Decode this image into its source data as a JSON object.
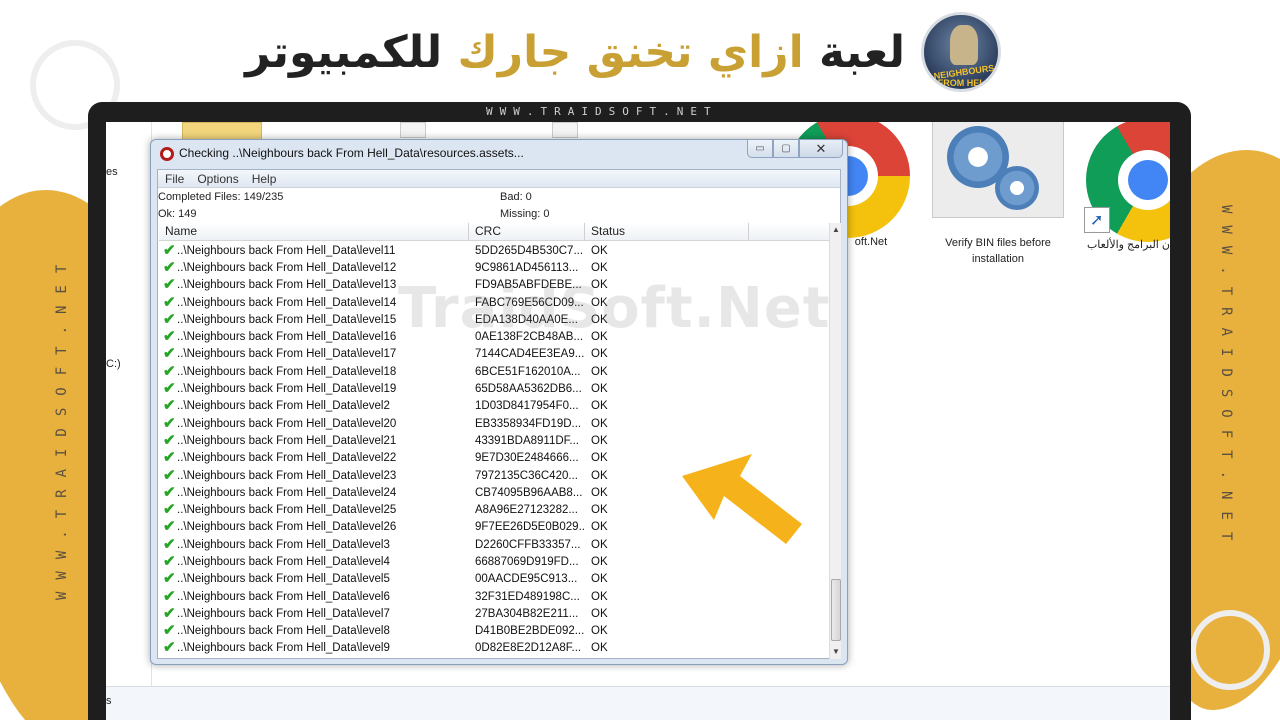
{
  "banner": {
    "headline_part1": "لعبة",
    "headline_part2": "ازاي تخنق جارك",
    "headline_part3": "للكمبيوتر",
    "logo_line1": "NEIGHBOURS",
    "logo_line2": "FROM HELL",
    "side_watermark": "WWW.TRAIDSOFT.NET",
    "url_watermark": "WWW.TRAIDSOFT.NET",
    "center_watermark": "TraidSoft.Net",
    "colors": {
      "gold": "#e8b13e",
      "headline_gold": "#c9a034",
      "dark": "#222222"
    }
  },
  "desktop": {
    "left_pane_text1": "es",
    "left_pane_text2": "C:)",
    "bottom_text": "s",
    "icons": [
      {
        "icon": "chrome-icon",
        "label": "oft.Net"
      },
      {
        "icon": "gears-icon",
        "label": "Verify BIN files before installation"
      },
      {
        "icon": "chrome-icon",
        "label": "ن البرامج والألعاب"
      }
    ]
  },
  "window": {
    "title": "Checking ..\\Neighbours back From Hell_Data\\resources.assets...",
    "buttons": {
      "minimize": "▭",
      "maximize": "▢",
      "close": "✕"
    },
    "menu": [
      "File",
      "Options",
      "Help"
    ],
    "stats": {
      "completed": "Completed Files: 149/235",
      "ok": "Ok: 149",
      "bad": "Bad: 0",
      "missing": "Missing: 0"
    },
    "columns": [
      "Name",
      "CRC",
      "Status"
    ],
    "rows": [
      {
        "name": "..\\Neighbours back From Hell_Data\\level11",
        "crc": "5DD265D4B530C7...",
        "status": "OK"
      },
      {
        "name": "..\\Neighbours back From Hell_Data\\level12",
        "crc": "9C9861AD456113...",
        "status": "OK"
      },
      {
        "name": "..\\Neighbours back From Hell_Data\\level13",
        "crc": "FD9AB5ABFDEBE...",
        "status": "OK"
      },
      {
        "name": "..\\Neighbours back From Hell_Data\\level14",
        "crc": "FABC769E56CD09...",
        "status": "OK"
      },
      {
        "name": "..\\Neighbours back From Hell_Data\\level15",
        "crc": "EDA138D40AA0E...",
        "status": "OK"
      },
      {
        "name": "..\\Neighbours back From Hell_Data\\level16",
        "crc": "0AE138F2CB48AB...",
        "status": "OK"
      },
      {
        "name": "..\\Neighbours back From Hell_Data\\level17",
        "crc": "7144CAD4EE3EA9...",
        "status": "OK"
      },
      {
        "name": "..\\Neighbours back From Hell_Data\\level18",
        "crc": "6BCE51F162010A...",
        "status": "OK"
      },
      {
        "name": "..\\Neighbours back From Hell_Data\\level19",
        "crc": "65D58AA5362DB6...",
        "status": "OK"
      },
      {
        "name": "..\\Neighbours back From Hell_Data\\level2",
        "crc": "1D03D8417954F0...",
        "status": "OK"
      },
      {
        "name": "..\\Neighbours back From Hell_Data\\level20",
        "crc": "EB3358934FD19D...",
        "status": "OK"
      },
      {
        "name": "..\\Neighbours back From Hell_Data\\level21",
        "crc": "43391BDA8911DF...",
        "status": "OK"
      },
      {
        "name": "..\\Neighbours back From Hell_Data\\level22",
        "crc": "9E7D30E2484666...",
        "status": "OK"
      },
      {
        "name": "..\\Neighbours back From Hell_Data\\level23",
        "crc": "7972135C36C420...",
        "status": "OK"
      },
      {
        "name": "..\\Neighbours back From Hell_Data\\level24",
        "crc": "CB74095B96AAB8...",
        "status": "OK"
      },
      {
        "name": "..\\Neighbours back From Hell_Data\\level25",
        "crc": "A8A96E27123282...",
        "status": "OK"
      },
      {
        "name": "..\\Neighbours back From Hell_Data\\level26",
        "crc": "9F7EE26D5E0B029...",
        "status": "OK"
      },
      {
        "name": "..\\Neighbours back From Hell_Data\\level3",
        "crc": "D2260CFFB33357...",
        "status": "OK"
      },
      {
        "name": "..\\Neighbours back From Hell_Data\\level4",
        "crc": "66887069D919FD...",
        "status": "OK"
      },
      {
        "name": "..\\Neighbours back From Hell_Data\\level5",
        "crc": "00AACDE95C913...",
        "status": "OK"
      },
      {
        "name": "..\\Neighbours back From Hell_Data\\level6",
        "crc": "32F31ED489198C...",
        "status": "OK"
      },
      {
        "name": "..\\Neighbours back From Hell_Data\\level7",
        "crc": "27BA304B82E211...",
        "status": "OK"
      },
      {
        "name": "..\\Neighbours back From Hell_Data\\level8",
        "crc": "D41B0BE2BDE092...",
        "status": "OK"
      },
      {
        "name": "..\\Neighbours back From Hell_Data\\level9",
        "crc": "0D82E8E2D12A8F...",
        "status": "OK"
      }
    ],
    "check_glyph": "✔",
    "scroll_up": "▲",
    "scroll_down": "▼"
  }
}
